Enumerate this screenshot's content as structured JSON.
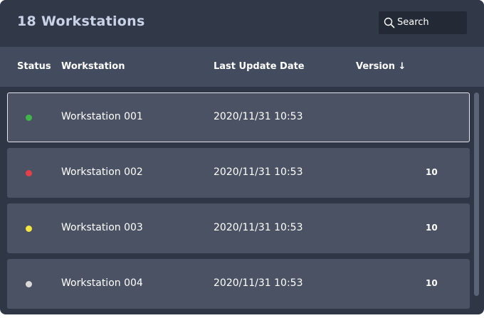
{
  "header": {
    "title": "18 Workstations",
    "search": {
      "label": "Search",
      "icon": "search-icon"
    }
  },
  "columns": {
    "status": "Status",
    "workstation": "Workstation",
    "last_update": "Last Update Date",
    "version": "Version ↓"
  },
  "rows": [
    {
      "status_color": "#3fb54a",
      "name": "Workstation 001",
      "date": "2020/11/31 10:53",
      "version": "",
      "selected": true
    },
    {
      "status_color": "#e5404a",
      "name": "Workstation 002",
      "date": "2020/11/31 10:53",
      "version": "10",
      "selected": false
    },
    {
      "status_color": "#f2e640",
      "name": "Workstation 003",
      "date": "2020/11/31 10:53",
      "version": "10",
      "selected": false
    },
    {
      "status_color": "#d9d9d9",
      "name": "Workstation 004",
      "date": "2020/11/31 10:53",
      "version": "10",
      "selected": false
    }
  ]
}
